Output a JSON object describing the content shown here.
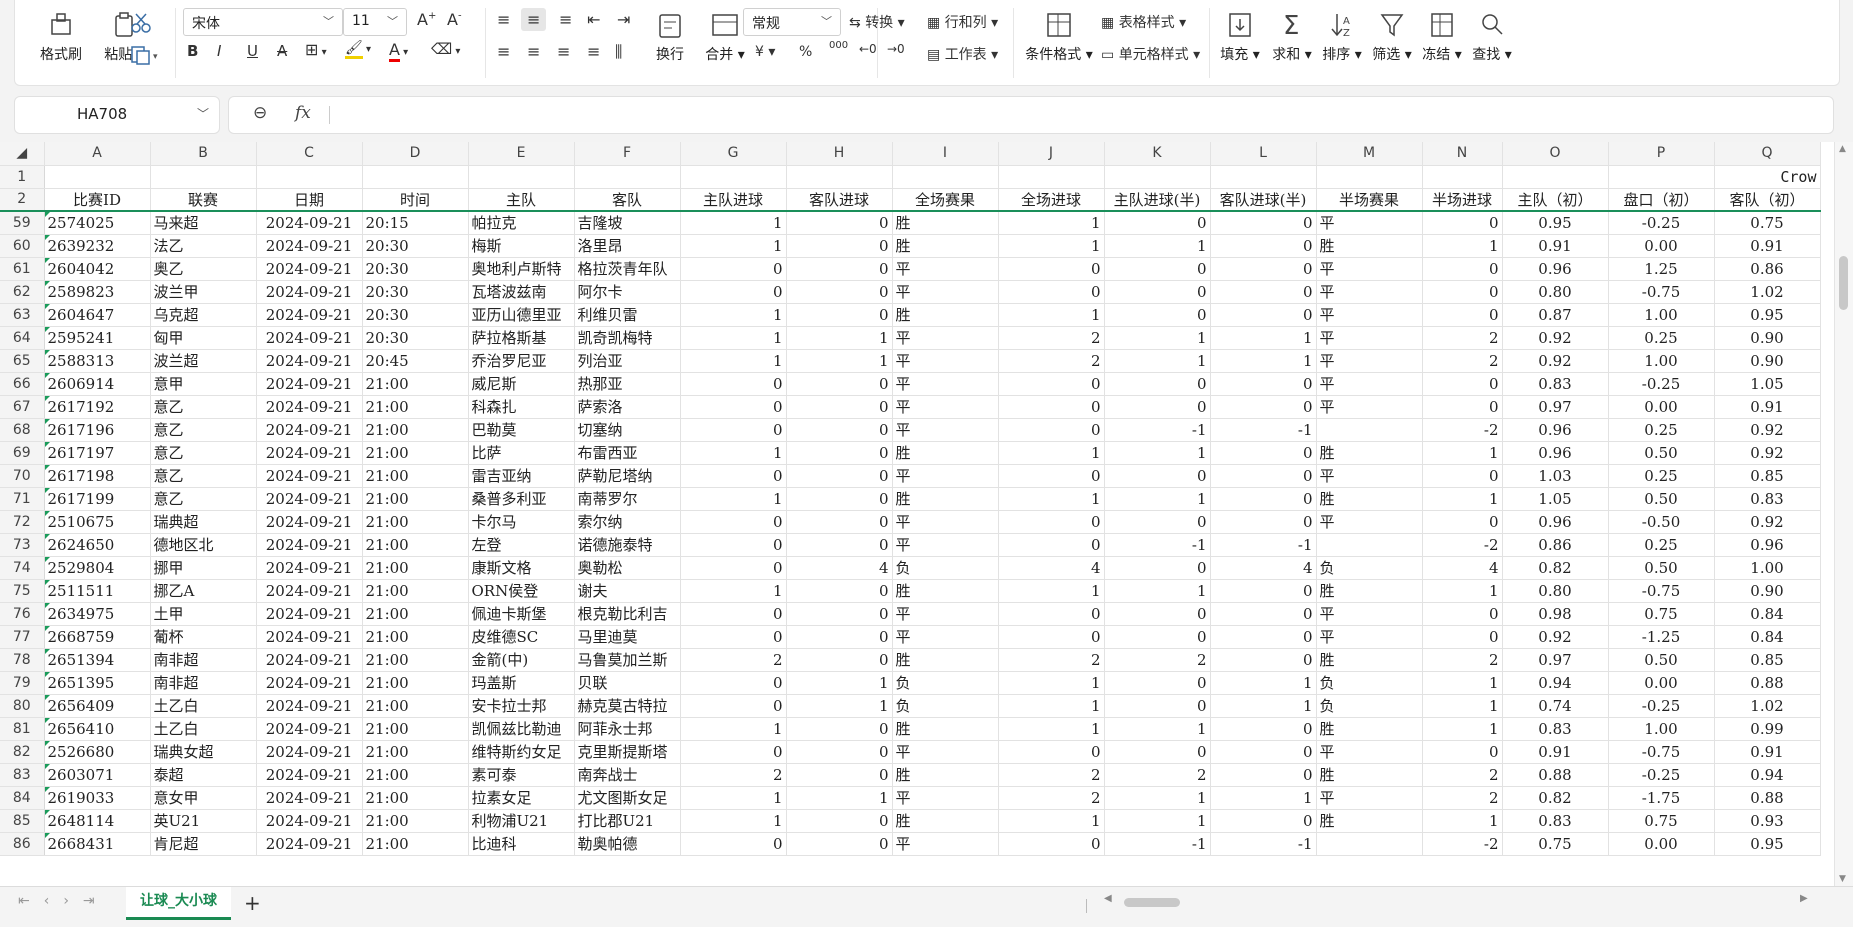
{
  "ribbon": {
    "format_painter": "格式刷",
    "paste": "粘贴",
    "font_name": "宋体",
    "font_size": "11",
    "wrap": "换行",
    "merge": "合并",
    "number_format": "常规",
    "convert": "转换",
    "row_col": "行和列",
    "worksheet": "工作表",
    "cond_format": "条件格式",
    "table_style": "表格样式",
    "cell_style": "单元格样式",
    "fill": "填充",
    "sum": "求和",
    "sort": "排序",
    "filter": "筛选",
    "freeze": "冻结",
    "find": "查找",
    "bold": "B",
    "italic": "I",
    "underline": "U",
    "strike": "A",
    "currency": "¥",
    "percent": "%",
    "thousands": "000"
  },
  "formula_bar": {
    "name_box": "HA708",
    "fx": "fx",
    "value": ""
  },
  "columns": [
    "A",
    "B",
    "C",
    "D",
    "E",
    "F",
    "G",
    "H",
    "I",
    "J",
    "K",
    "L",
    "M",
    "N",
    "O",
    "P",
    "Q"
  ],
  "overflow_text": "Crow",
  "headers": [
    "比赛ID",
    "联赛",
    "日期",
    "时间",
    "主队",
    "客队",
    "主队进球",
    "客队进球",
    "全场赛果",
    "全场进球",
    "主队进球(半)",
    "客队进球(半)",
    "半场赛果",
    "半场进球",
    "主队（初）",
    "盘口（初）",
    "客队（初）"
  ],
  "rows": [
    {
      "n": "59",
      "c": [
        "2574025",
        "马来超",
        "2024-09-21",
        "20:15",
        "帕拉克",
        "吉隆坡",
        "1",
        "0",
        "胜",
        "1",
        "0",
        "0",
        "平",
        "0",
        "0.95",
        "-0.25",
        "0.75"
      ]
    },
    {
      "n": "60",
      "c": [
        "2639232",
        "法乙",
        "2024-09-21",
        "20:30",
        "梅斯",
        "洛里昂",
        "1",
        "0",
        "胜",
        "1",
        "1",
        "0",
        "胜",
        "1",
        "0.91",
        "0.00",
        "0.91"
      ]
    },
    {
      "n": "61",
      "c": [
        "2604042",
        "奥乙",
        "2024-09-21",
        "20:30",
        "奥地利卢斯特",
        "格拉茨青年队",
        "0",
        "0",
        "平",
        "0",
        "0",
        "0",
        "平",
        "0",
        "0.96",
        "1.25",
        "0.86"
      ]
    },
    {
      "n": "62",
      "c": [
        "2589823",
        "波兰甲",
        "2024-09-21",
        "20:30",
        "瓦塔波兹南",
        "阿尔卡",
        "0",
        "0",
        "平",
        "0",
        "0",
        "0",
        "平",
        "0",
        "0.80",
        "-0.75",
        "1.02"
      ]
    },
    {
      "n": "63",
      "c": [
        "2604647",
        "乌克超",
        "2024-09-21",
        "20:30",
        "亚历山德里亚",
        "利维贝雷",
        "1",
        "0",
        "胜",
        "1",
        "0",
        "0",
        "平",
        "0",
        "0.87",
        "1.00",
        "0.95"
      ]
    },
    {
      "n": "64",
      "c": [
        "2595241",
        "匈甲",
        "2024-09-21",
        "20:30",
        "萨拉格斯基",
        "凯奇凯梅特",
        "1",
        "1",
        "平",
        "2",
        "1",
        "1",
        "平",
        "2",
        "0.92",
        "0.25",
        "0.90"
      ]
    },
    {
      "n": "65",
      "c": [
        "2588313",
        "波兰超",
        "2024-09-21",
        "20:45",
        "乔治罗尼亚",
        "列治亚",
        "1",
        "1",
        "平",
        "2",
        "1",
        "1",
        "平",
        "2",
        "0.92",
        "1.00",
        "0.90"
      ]
    },
    {
      "n": "66",
      "c": [
        "2606914",
        "意甲",
        "2024-09-21",
        "21:00",
        "威尼斯",
        "热那亚",
        "0",
        "0",
        "平",
        "0",
        "0",
        "0",
        "平",
        "0",
        "0.83",
        "-0.25",
        "1.05"
      ]
    },
    {
      "n": "67",
      "c": [
        "2617192",
        "意乙",
        "2024-09-21",
        "21:00",
        "科森扎",
        "萨索洛",
        "0",
        "0",
        "平",
        "0",
        "0",
        "0",
        "平",
        "0",
        "0.97",
        "0.00",
        "0.91"
      ]
    },
    {
      "n": "68",
      "c": [
        "2617196",
        "意乙",
        "2024-09-21",
        "21:00",
        "巴勒莫",
        "切塞纳",
        "0",
        "0",
        "平",
        "0",
        "-1",
        "-1",
        "",
        "-2",
        "0.96",
        "0.25",
        "0.92"
      ]
    },
    {
      "n": "69",
      "c": [
        "2617197",
        "意乙",
        "2024-09-21",
        "21:00",
        "比萨",
        "布雷西亚",
        "1",
        "0",
        "胜",
        "1",
        "1",
        "0",
        "胜",
        "1",
        "0.96",
        "0.50",
        "0.92"
      ]
    },
    {
      "n": "70",
      "c": [
        "2617198",
        "意乙",
        "2024-09-21",
        "21:00",
        "雷吉亚纳",
        "萨勒尼塔纳",
        "0",
        "0",
        "平",
        "0",
        "0",
        "0",
        "平",
        "0",
        "1.03",
        "0.25",
        "0.85"
      ]
    },
    {
      "n": "71",
      "c": [
        "2617199",
        "意乙",
        "2024-09-21",
        "21:00",
        "桑普多利亚",
        "南蒂罗尔",
        "1",
        "0",
        "胜",
        "1",
        "1",
        "0",
        "胜",
        "1",
        "1.05",
        "0.50",
        "0.83"
      ]
    },
    {
      "n": "72",
      "c": [
        "2510675",
        "瑞典超",
        "2024-09-21",
        "21:00",
        "卡尔马",
        "索尔纳",
        "0",
        "0",
        "平",
        "0",
        "0",
        "0",
        "平",
        "0",
        "0.96",
        "-0.50",
        "0.92"
      ]
    },
    {
      "n": "73",
      "c": [
        "2624650",
        "德地区北",
        "2024-09-21",
        "21:00",
        "左登",
        "诺德施泰特",
        "0",
        "0",
        "平",
        "0",
        "-1",
        "-1",
        "",
        "-2",
        "0.86",
        "0.25",
        "0.96"
      ]
    },
    {
      "n": "74",
      "c": [
        "2529804",
        "挪甲",
        "2024-09-21",
        "21:00",
        "康斯文格",
        "奥勒松",
        "0",
        "4",
        "负",
        "4",
        "0",
        "4",
        "负",
        "4",
        "0.82",
        "0.50",
        "1.00"
      ]
    },
    {
      "n": "75",
      "c": [
        "2511511",
        "挪乙A",
        "2024-09-21",
        "21:00",
        "ORN侯登",
        "谢夫",
        "1",
        "0",
        "胜",
        "1",
        "1",
        "0",
        "胜",
        "1",
        "0.80",
        "-0.75",
        "0.90"
      ]
    },
    {
      "n": "76",
      "c": [
        "2634975",
        "土甲",
        "2024-09-21",
        "21:00",
        "佩迪卡斯堡",
        "根克勒比利吉",
        "0",
        "0",
        "平",
        "0",
        "0",
        "0",
        "平",
        "0",
        "0.98",
        "0.75",
        "0.84"
      ]
    },
    {
      "n": "77",
      "c": [
        "2668759",
        "葡杯",
        "2024-09-21",
        "21:00",
        "皮维德SC",
        "马里迪莫",
        "0",
        "0",
        "平",
        "0",
        "0",
        "0",
        "平",
        "0",
        "0.92",
        "-1.25",
        "0.84"
      ]
    },
    {
      "n": "78",
      "c": [
        "2651394",
        "南非超",
        "2024-09-21",
        "21:00",
        "金箭(中)",
        "马鲁莫加兰斯",
        "2",
        "0",
        "胜",
        "2",
        "2",
        "0",
        "胜",
        "2",
        "0.97",
        "0.50",
        "0.85"
      ]
    },
    {
      "n": "79",
      "c": [
        "2651395",
        "南非超",
        "2024-09-21",
        "21:00",
        "玛盖斯",
        "贝联",
        "0",
        "1",
        "负",
        "1",
        "0",
        "1",
        "负",
        "1",
        "0.94",
        "0.00",
        "0.88"
      ]
    },
    {
      "n": "80",
      "c": [
        "2656409",
        "土乙白",
        "2024-09-21",
        "21:00",
        "安卡拉士邦",
        "赫克莫古特拉",
        "0",
        "1",
        "负",
        "1",
        "0",
        "1",
        "负",
        "1",
        "0.74",
        "-0.25",
        "1.02"
      ]
    },
    {
      "n": "81",
      "c": [
        "2656410",
        "土乙白",
        "2024-09-21",
        "21:00",
        "凯佩兹比勒迪",
        "阿菲永士邦",
        "1",
        "0",
        "胜",
        "1",
        "1",
        "0",
        "胜",
        "1",
        "0.83",
        "1.00",
        "0.99"
      ]
    },
    {
      "n": "82",
      "c": [
        "2526680",
        "瑞典女超",
        "2024-09-21",
        "21:00",
        "维特斯约女足",
        "克里斯提斯塔",
        "0",
        "0",
        "平",
        "0",
        "0",
        "0",
        "平",
        "0",
        "0.91",
        "-0.75",
        "0.91"
      ]
    },
    {
      "n": "83",
      "c": [
        "2603071",
        "泰超",
        "2024-09-21",
        "21:00",
        "素可泰",
        "南奔战士",
        "2",
        "0",
        "胜",
        "2",
        "2",
        "0",
        "胜",
        "2",
        "0.88",
        "-0.25",
        "0.94"
      ]
    },
    {
      "n": "84",
      "c": [
        "2619033",
        "意女甲",
        "2024-09-21",
        "21:00",
        "拉素女足",
        "尤文图斯女足",
        "1",
        "1",
        "平",
        "2",
        "1",
        "1",
        "平",
        "2",
        "0.82",
        "-1.75",
        "0.88"
      ]
    },
    {
      "n": "85",
      "c": [
        "2648114",
        "英U21",
        "2024-09-21",
        "21:00",
        "利物浦U21",
        "打比郡U21",
        "1",
        "0",
        "胜",
        "1",
        "1",
        "0",
        "胜",
        "1",
        "0.83",
        "0.75",
        "0.93"
      ]
    },
    {
      "n": "86",
      "c": [
        "2668431",
        "肯尼超",
        "2024-09-21",
        "21:00",
        "比迪科",
        "勒奥帕德",
        "0",
        "0",
        "平",
        "0",
        "-1",
        "-1",
        "",
        "-2",
        "0.75",
        "0.00",
        "0.95"
      ]
    }
  ],
  "sheet_tab": "让球_大小球"
}
